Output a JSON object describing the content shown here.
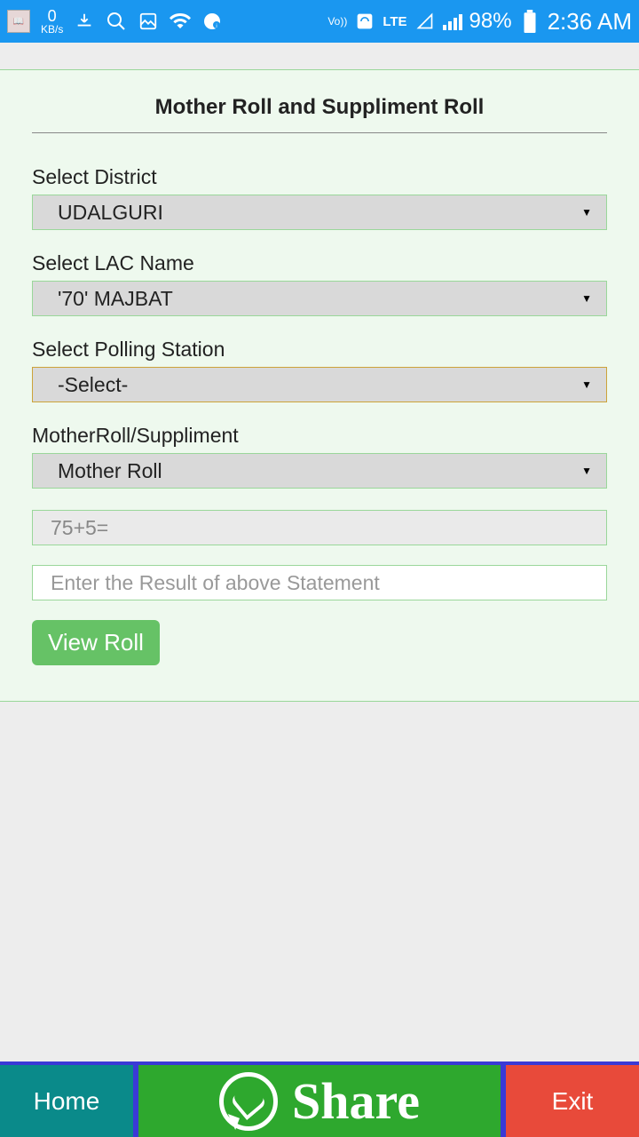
{
  "statusbar": {
    "speed_value": "0",
    "speed_unit": "KB/s",
    "volte": "Vo))",
    "lte": "LTE",
    "battery": "98%",
    "time": "2:36 AM"
  },
  "page": {
    "title": "Mother Roll and Suppliment Roll"
  },
  "fields": {
    "district_label": "Select District",
    "district_value": "UDALGURI",
    "lac_label": "Select LAC Name",
    "lac_value": "'70' MAJBAT",
    "polling_label": "Select Polling Station",
    "polling_value": "-Select-",
    "rolltype_label": "MotherRoll/Suppliment",
    "rolltype_value": "Mother Roll",
    "captcha_text": "75+5=",
    "result_placeholder": "Enter the Result of above Statement",
    "view_button": "View Roll"
  },
  "nav": {
    "home": "Home",
    "share": "Share",
    "exit": "Exit"
  }
}
